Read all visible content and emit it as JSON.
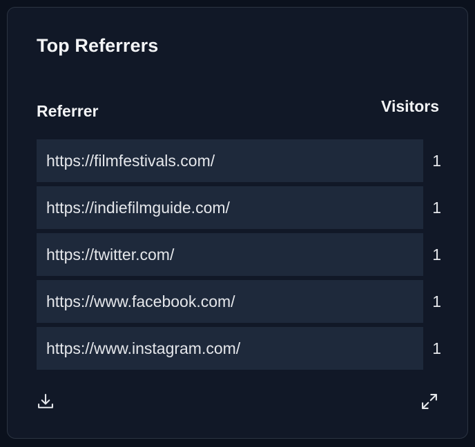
{
  "card": {
    "title": "Top Referrers",
    "columns": {
      "referrer": "Referrer",
      "visitors": "Visitors"
    },
    "rows": [
      {
        "referrer": "https://filmfestivals.com/",
        "visitors": "1"
      },
      {
        "referrer": "https://indiefilmguide.com/",
        "visitors": "1"
      },
      {
        "referrer": "https://twitter.com/",
        "visitors": "1"
      },
      {
        "referrer": "https://www.facebook.com/",
        "visitors": "1"
      },
      {
        "referrer": "https://www.instagram.com/",
        "visitors": "1"
      }
    ],
    "footer": {
      "download_icon": "download-icon",
      "expand_icon": "expand-icon"
    }
  },
  "colors": {
    "background": "#0b111d",
    "card": "#111827",
    "row_bar": "#1e293b",
    "text": "#e5e7eb"
  }
}
